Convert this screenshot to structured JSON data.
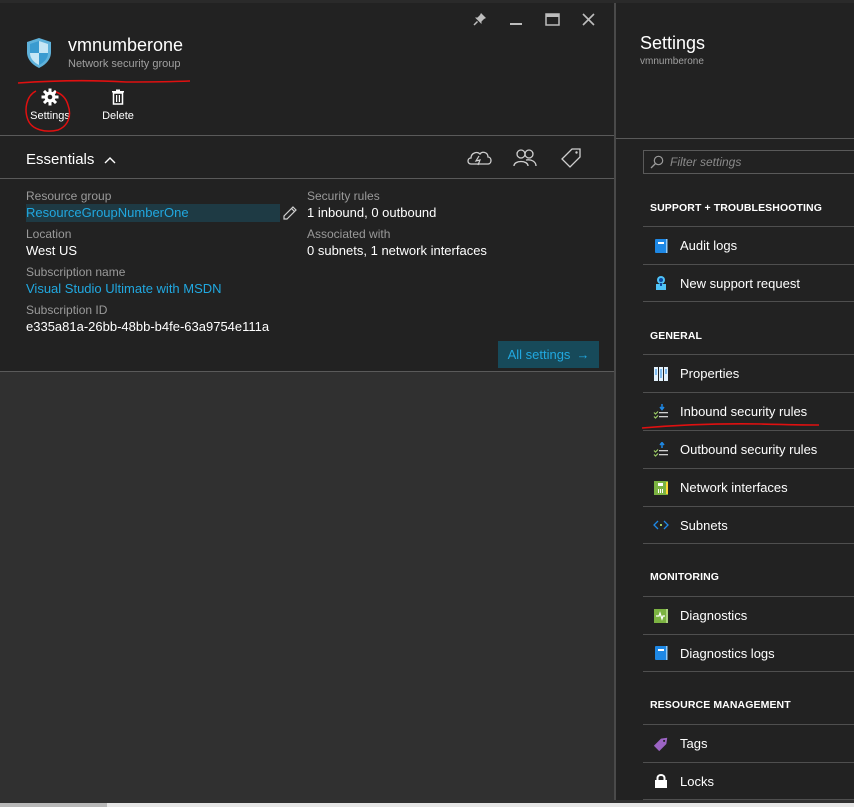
{
  "resource": {
    "name": "vmnumberone",
    "type": "Network security group",
    "shield_icon": "shield-icon"
  },
  "window_controls": {
    "pin": "pin-icon",
    "minimize": "minimize-icon",
    "maximize": "maximize-icon",
    "close": "close-icon"
  },
  "commands": [
    {
      "label": "Settings",
      "icon": "gear-icon"
    },
    {
      "label": "Delete",
      "icon": "trash-icon"
    }
  ],
  "essentials": {
    "title": "Essentials",
    "toggle_icon": "chevron-up-icon",
    "header_icons": [
      "cloud-icon",
      "users-icon",
      "tag-icon"
    ],
    "left": [
      {
        "label": "Resource group",
        "value": "ResourceGroupNumberOne",
        "link": true
      },
      {
        "label": "Location",
        "value": "West US",
        "link": false
      },
      {
        "label": "Subscription name",
        "value": "Visual Studio Ultimate with MSDN",
        "link": true
      },
      {
        "label": "Subscription ID",
        "value": "e335a81a-26bb-48bb-b4fe-63a9754e111a",
        "link": false
      }
    ],
    "right": [
      {
        "label": "Security rules",
        "value": "1 inbound, 0 outbound"
      },
      {
        "label": "Associated with",
        "value": "0 subnets, 1 network interfaces"
      }
    ],
    "all_settings_label": "All settings",
    "all_settings_arrow": "→"
  },
  "settings_blade": {
    "title": "Settings",
    "subtitle": "vmnumberone",
    "filter_placeholder": "Filter settings",
    "sections": [
      {
        "heading": "SUPPORT + TROUBLESHOOTING",
        "items": [
          {
            "label": "Audit logs",
            "icon": "audit-log-icon"
          },
          {
            "label": "New support request",
            "icon": "support-request-icon"
          }
        ]
      },
      {
        "heading": "GENERAL",
        "items": [
          {
            "label": "Properties",
            "icon": "properties-icon"
          },
          {
            "label": "Inbound security rules",
            "icon": "inbound-rules-icon"
          },
          {
            "label": "Outbound security rules",
            "icon": "outbound-rules-icon"
          },
          {
            "label": "Network interfaces",
            "icon": "network-interface-icon"
          },
          {
            "label": "Subnets",
            "icon": "subnets-icon"
          }
        ]
      },
      {
        "heading": "MONITORING",
        "items": [
          {
            "label": "Diagnostics",
            "icon": "diagnostics-icon"
          },
          {
            "label": "Diagnostics logs",
            "icon": "diagnostics-log-icon"
          }
        ]
      },
      {
        "heading": "RESOURCE MANAGEMENT",
        "items": [
          {
            "label": "Tags",
            "icon": "tag-icon"
          },
          {
            "label": "Locks",
            "icon": "lock-icon"
          }
        ]
      }
    ]
  },
  "colors": {
    "accent_link": "#21a8e0",
    "blade_bg": "#222222",
    "desktop_bg": "#303030",
    "annotation_red": "#e01010"
  }
}
